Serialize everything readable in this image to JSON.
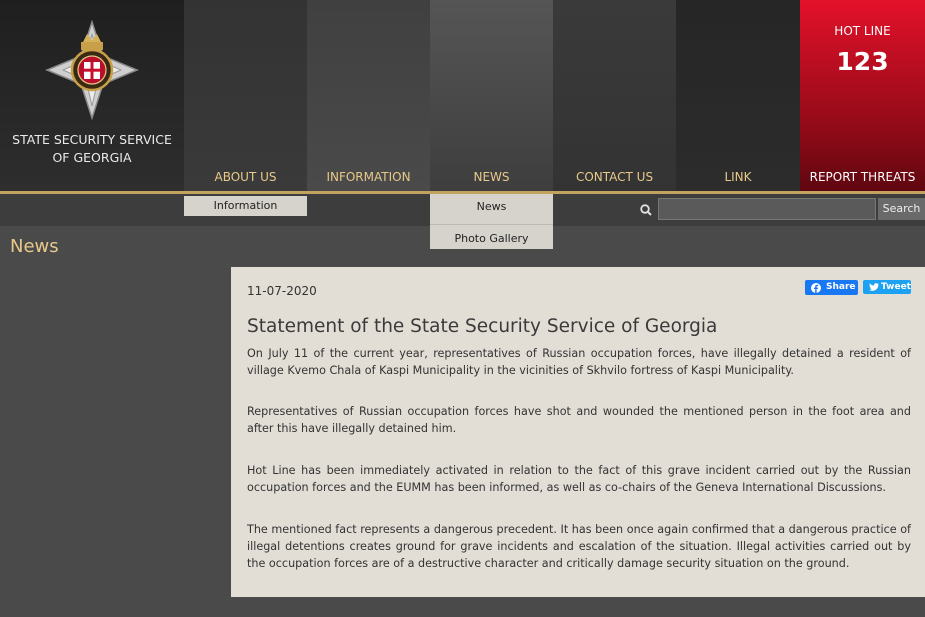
{
  "org": {
    "name_line1": "STATE SECURITY SERVICE",
    "name_line2": "OF GEORGIA"
  },
  "nav": {
    "items": [
      "ABOUT US",
      "INFORMATION",
      "NEWS",
      "CONTACT US",
      "LINK"
    ],
    "hotline_title": "HOT LINE",
    "hotline_number": "123",
    "report_label": "REPORT THREATS"
  },
  "dropdowns": {
    "about_us": [
      "Information"
    ],
    "news": [
      "News",
      "Photo Gallery"
    ]
  },
  "search": {
    "button_label": "Search",
    "placeholder": ""
  },
  "page": {
    "title": "News"
  },
  "article": {
    "date": "11-07-2020",
    "share_label": "Share",
    "tweet_label": "Tweet",
    "title": "Statement of the State Security Service of Georgia",
    "paragraphs": [
      "On July 11 of the current year, representatives of Russian occupation forces, have illegally detained a resident of village Kvemo Chala of Kaspi Municipality in the vicinities of Skhvilo fortress of Kaspi Municipality.",
      "Representatives of Russian occupation forces have shot and wounded the mentioned person in the foot area and after this have illegally detained him.",
      "Hot Line has been immediately activated in relation to the fact of this grave incident carried out by the Russian occupation forces and the EUMM has been informed, as well as co-chairs of the Geneva International Discussions.",
      "The mentioned fact represents a dangerous precedent. It has been once again confirmed that a dangerous practice of illegal detentions creates ground for grave incidents and escalation of the situation. Illegal activities carried out by the occupation forces are of a destructive character and critically damage security situation on the ground."
    ]
  },
  "colors": {
    "accent_gold": "#e8c98a",
    "hotline_red": "#e3112a",
    "share_blue": "#1877f2",
    "tweet_blue": "#1da1f2"
  }
}
